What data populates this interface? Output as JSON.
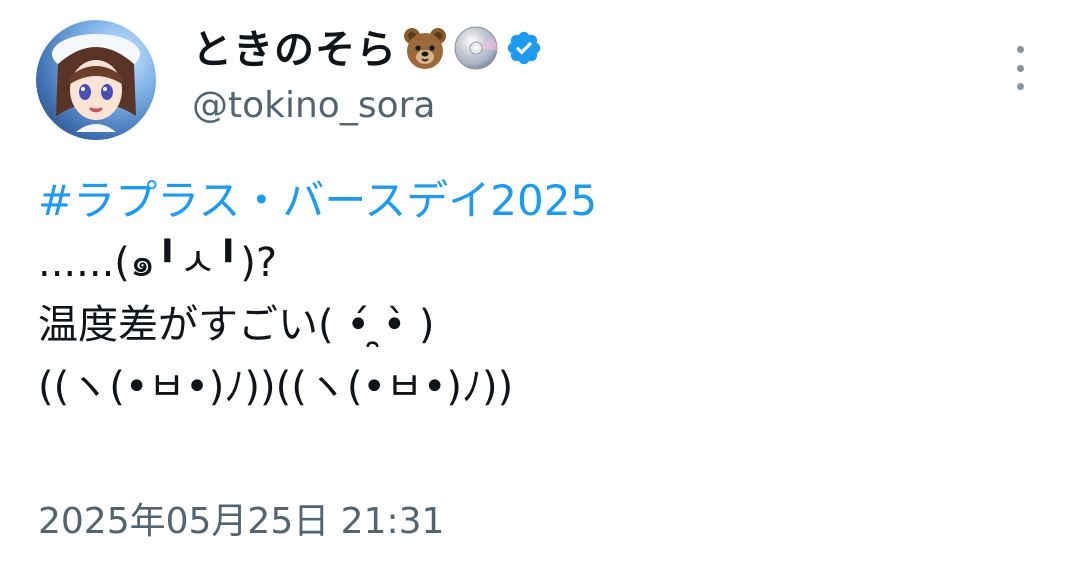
{
  "author": {
    "display_name": "ときのそら",
    "handle": "@tokino_sora",
    "name_emojis": [
      "bear-face",
      "optical-disc"
    ],
    "verified": true
  },
  "tweet": {
    "hashtag": "#ラプラス・バースデイ2025",
    "lines": [
      "......(๑╹ㅅ╹)?",
      "温度差がすごい( •́ ̯•̀ )",
      "((ヽ(•ㅂ•)ﾉ))((ヽ(•ㅂ•)ﾉ))"
    ],
    "timestamp": "2025年05月25日 21:31"
  },
  "colors": {
    "link": "#1d9bf0",
    "secondary_text": "#536471",
    "verified_badge": "#1d9bf0"
  }
}
